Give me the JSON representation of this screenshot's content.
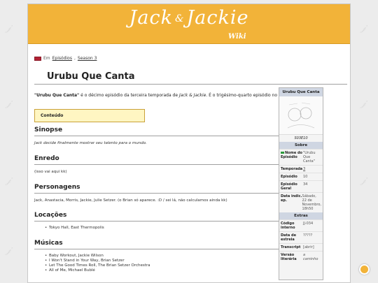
{
  "banner": {
    "logo_main": "Jack",
    "logo_amp": "&",
    "logo_second": "Jackie",
    "logo_sub": "Wiki"
  },
  "breadcrumb": {
    "prefix": "Em",
    "link1": "Episódios",
    "sep": ",",
    "link2": "Season 3"
  },
  "page": {
    "title": "Urubu Que Canta"
  },
  "intro": {
    "bold_title": "\"Urubu Que Canta\"",
    "text_a": " é o décimo episódio da terceira temporada de ",
    "show": "Jack & Jackie",
    "text_b": ". É o trigésimo-quarto episódio no total."
  },
  "toc": {
    "label": "Conteúdo"
  },
  "sections": {
    "sinopse": {
      "heading": "Sinopse",
      "text": "Jack decide finalmente mostrar seu talento para o mundo."
    },
    "enredo": {
      "heading": "Enredo",
      "text": "(isso vai aqui kk)"
    },
    "personagens": {
      "heading": "Personagens",
      "text": "Jack, Anastacia, Morris, Jackie, Julie Setzer. (o Brian só aparece. :D / sei lá, não calculamos ainda kk)"
    },
    "locacoes": {
      "heading": "Locações",
      "items": [
        "Tokyo Hall, East Thermopolis"
      ]
    },
    "musicas": {
      "heading": "Músicas",
      "items": [
        "Baby Workout, Jackie Wilson",
        "I Won't Stand in Your Way, Brian Setzer",
        "Let The Good Times Roll, The Brian Setzer Orchestra",
        "All of Me, Michael Bublé"
      ]
    }
  },
  "infobox": {
    "title": "Urubu Que Canta",
    "caption": "S03E10",
    "section_sobre": "Sobre",
    "rows": [
      {
        "key": "Nome do Episódio",
        "value": "\"Urubu Que Canta\""
      },
      {
        "key": "Temporada",
        "value": "3"
      },
      {
        "key": "Episódio",
        "value": "10"
      },
      {
        "key": "Episódio Geral",
        "value": "34"
      },
      {
        "key": "Data indic. ep.",
        "value": "Sábado, 22 de Novembro, 18h50"
      }
    ],
    "section_extras": "Extras",
    "extras": [
      {
        "key": "Código interno",
        "value": "JJ-034"
      },
      {
        "key": "Data de estreia",
        "value": "?????"
      },
      {
        "key": "Transcript",
        "value": "[abrir]"
      },
      {
        "key": "Versão literária",
        "value": "a caminho"
      }
    ]
  },
  "colors": {
    "banner": "#f2b339",
    "toc_bg": "#fff6c2",
    "infobox_head": "#cfd6e2"
  }
}
